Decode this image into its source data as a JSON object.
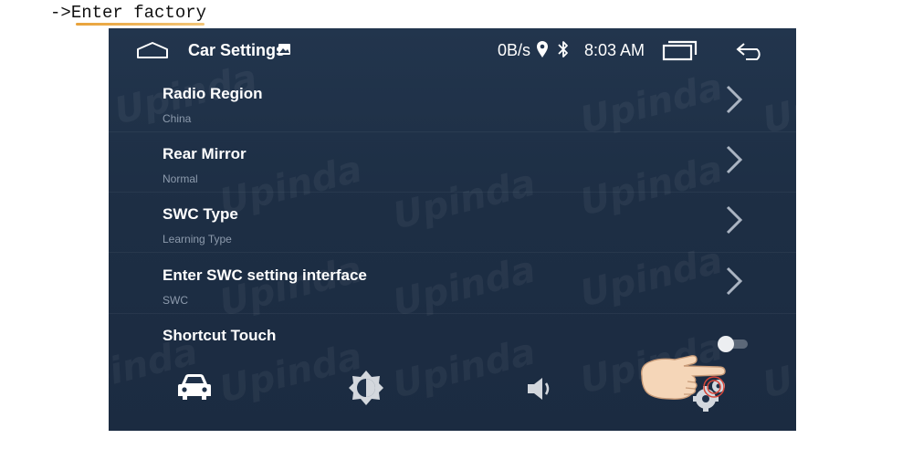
{
  "caption": {
    "arrow": "->",
    "text": "Enter factory"
  },
  "statusbar": {
    "title": "Car Settings",
    "net_speed": "0B/s",
    "time": "8:03 AM"
  },
  "settings": [
    {
      "label": "Radio Region",
      "value": "China"
    },
    {
      "label": "Rear Mirror",
      "value": "Normal"
    },
    {
      "label": "SWC Type",
      "value": "Learning Type"
    },
    {
      "label": "Enter SWC setting interface",
      "value": "SWC"
    },
    {
      "label": "Shortcut Touch",
      "value": ""
    }
  ],
  "shortcut_touch_enabled": false,
  "bottom_nav": [
    "car-icon",
    "brightness-icon",
    "volume-icon",
    "settings-gear-icon"
  ],
  "watermark": "Upinda",
  "colors": {
    "background": "#1f3149",
    "subtext": "#8d9bad",
    "hand": "#f5d6b8",
    "highlight": "#d6463a"
  }
}
